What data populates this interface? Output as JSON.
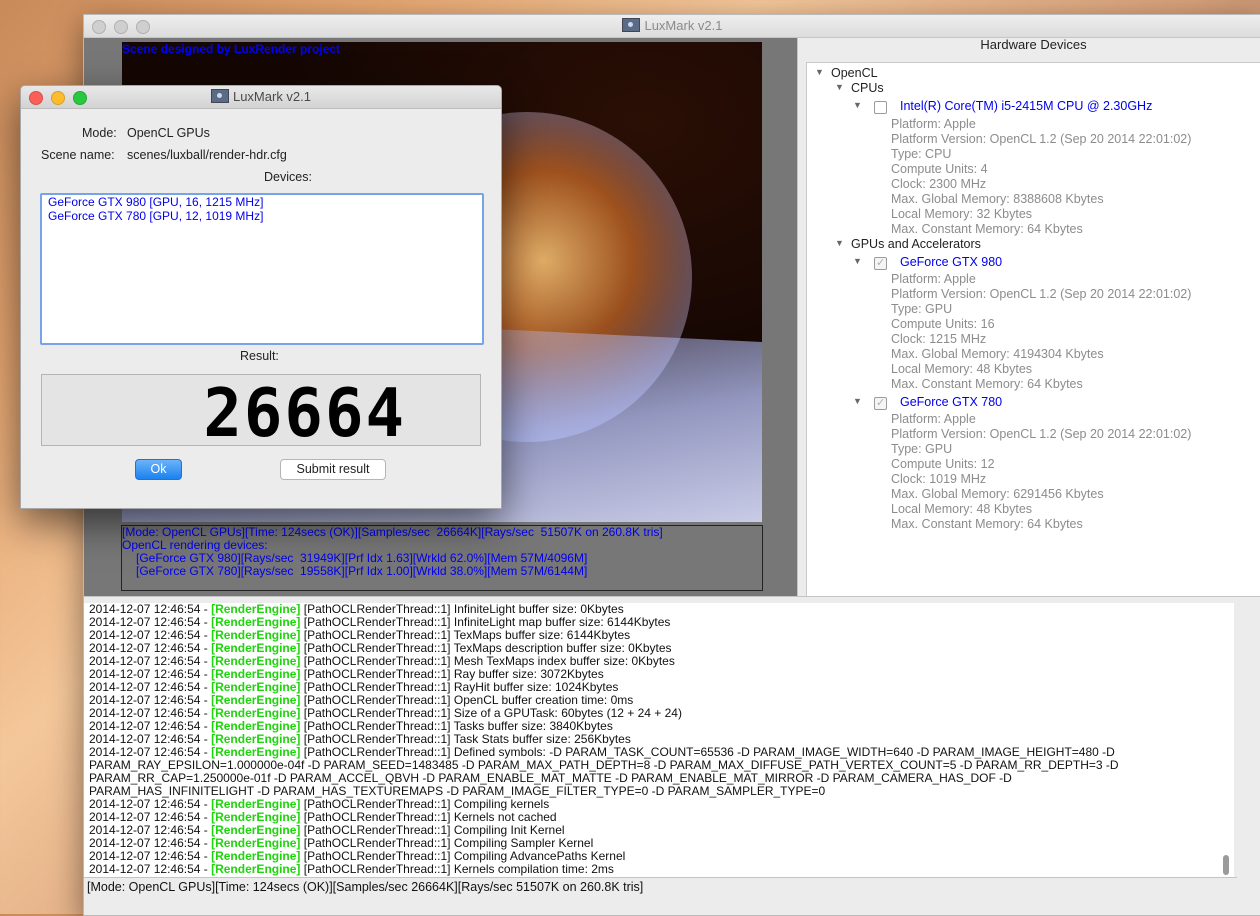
{
  "main_window": {
    "title": "LuxMark v2.1"
  },
  "render": {
    "scene_credit": "Scene designed by LuxRender project",
    "stats_lines": [
      "[Mode: OpenCL GPUs][Time: 124secs (OK)][Samples/sec  26664K][Rays/sec  51507K on 260.8K tris]",
      "",
      "OpenCL rendering devices:",
      "[GeForce GTX 980][Rays/sec  31949K][Prf Idx 1.63][Wrkld 62.0%][Mem 57M/4096M]",
      "[GeForce GTX 780][Rays/sec  19558K][Prf Idx 1.00][Wrkld 38.0%][Mem 57M/6144M]"
    ]
  },
  "hardware": {
    "title": "Hardware Devices",
    "root": "OpenCL",
    "cpus_label": "CPUs",
    "gpus_label": "GPUs and Accelerators",
    "cpu": {
      "name": "Intel(R) Core(TM) i5-2415M CPU @ 2.30GHz",
      "checked": false,
      "props": [
        "Platform: Apple",
        "Platform Version: OpenCL 1.2 (Sep 20 2014 22:01:02)",
        "Type: CPU",
        "Compute Units: 4",
        "Clock: 2300 MHz",
        "Max. Global Memory: 8388608 Kbytes",
        "Local Memory: 32 Kbytes",
        "Max. Constant Memory: 64 Kbytes"
      ]
    },
    "gpus": [
      {
        "name": "GeForce GTX 980",
        "checked": true,
        "props": [
          "Platform: Apple",
          "Platform Version: OpenCL 1.2 (Sep 20 2014 22:01:02)",
          "Type: GPU",
          "Compute Units: 16",
          "Clock: 1215 MHz",
          "Max. Global Memory: 4194304 Kbytes",
          "Local Memory: 48 Kbytes",
          "Max. Constant Memory: 64 Kbytes"
        ]
      },
      {
        "name": "GeForce GTX 780",
        "checked": true,
        "props": [
          "Platform: Apple",
          "Platform Version: OpenCL 1.2 (Sep 20 2014 22:01:02)",
          "Type: GPU",
          "Compute Units: 12",
          "Clock: 1019 MHz",
          "Max. Global Memory: 6291456 Kbytes",
          "Local Memory: 48 Kbytes",
          "Max. Constant Memory: 64 Kbytes"
        ]
      }
    ]
  },
  "log": {
    "engine_tag": "[RenderEngine]",
    "lines": [
      {
        "ts": "2014-12-07 12:46:54 - ",
        "eng": true,
        "rest": " [PathOCLRenderThread::1] InfiniteLight buffer size: 0Kbytes"
      },
      {
        "ts": "2014-12-07 12:46:54 - ",
        "eng": true,
        "rest": " [PathOCLRenderThread::1] InfiniteLight map buffer size: 6144Kbytes"
      },
      {
        "ts": "2014-12-07 12:46:54 - ",
        "eng": true,
        "rest": " [PathOCLRenderThread::1] TexMaps buffer size: 6144Kbytes"
      },
      {
        "ts": "2014-12-07 12:46:54 - ",
        "eng": true,
        "rest": " [PathOCLRenderThread::1] TexMaps description buffer size: 0Kbytes"
      },
      {
        "ts": "2014-12-07 12:46:54 - ",
        "eng": true,
        "rest": " [PathOCLRenderThread::1] Mesh TexMaps index buffer size: 0Kbytes"
      },
      {
        "ts": "2014-12-07 12:46:54 - ",
        "eng": true,
        "rest": " [PathOCLRenderThread::1] Ray buffer size: 3072Kbytes"
      },
      {
        "ts": "2014-12-07 12:46:54 - ",
        "eng": true,
        "rest": " [PathOCLRenderThread::1] RayHit buffer size: 1024Kbytes"
      },
      {
        "ts": "2014-12-07 12:46:54 - ",
        "eng": true,
        "rest": " [PathOCLRenderThread::1] OpenCL buffer creation time: 0ms"
      },
      {
        "ts": "2014-12-07 12:46:54 - ",
        "eng": true,
        "rest": " [PathOCLRenderThread::1] Size of a GPUTask: 60bytes (12 + 24 + 24)"
      },
      {
        "ts": "2014-12-07 12:46:54 - ",
        "eng": true,
        "rest": " [PathOCLRenderThread::1] Tasks buffer size: 3840Kbytes"
      },
      {
        "ts": "2014-12-07 12:46:54 - ",
        "eng": true,
        "rest": " [PathOCLRenderThread::1] Task Stats buffer size: 256Kbytes"
      },
      {
        "ts": "2014-12-07 12:46:54 - ",
        "eng": true,
        "rest": " [PathOCLRenderThread::1] Defined symbols: -D PARAM_TASK_COUNT=65536 -D PARAM_IMAGE_WIDTH=640 -D PARAM_IMAGE_HEIGHT=480 -D"
      },
      {
        "ts": "",
        "eng": false,
        "rest": "PARAM_RAY_EPSILON=1.000000e-04f -D PARAM_SEED=1483485 -D PARAM_MAX_PATH_DEPTH=8 -D PARAM_MAX_DIFFUSE_PATH_VERTEX_COUNT=5 -D PARAM_RR_DEPTH=3 -D"
      },
      {
        "ts": "",
        "eng": false,
        "rest": "PARAM_RR_CAP=1.250000e-01f -D PARAM_ACCEL_QBVH -D PARAM_ENABLE_MAT_MATTE -D PARAM_ENABLE_MAT_MIRROR -D PARAM_CAMERA_HAS_DOF -D"
      },
      {
        "ts": "",
        "eng": false,
        "rest": "PARAM_HAS_INFINITELIGHT -D PARAM_HAS_TEXTUREMAPS -D PARAM_IMAGE_FILTER_TYPE=0 -D PARAM_SAMPLER_TYPE=0"
      },
      {
        "ts": "2014-12-07 12:46:54 - ",
        "eng": true,
        "rest": " [PathOCLRenderThread::1] Compiling kernels"
      },
      {
        "ts": "2014-12-07 12:46:54 - ",
        "eng": true,
        "rest": " [PathOCLRenderThread::1] Kernels not cached"
      },
      {
        "ts": "2014-12-07 12:46:54 - ",
        "eng": true,
        "rest": " [PathOCLRenderThread::1] Compiling Init Kernel"
      },
      {
        "ts": "2014-12-07 12:46:54 - ",
        "eng": true,
        "rest": " [PathOCLRenderThread::1] Compiling Sampler Kernel"
      },
      {
        "ts": "2014-12-07 12:46:54 - ",
        "eng": true,
        "rest": " [PathOCLRenderThread::1] Compiling AdvancePaths Kernel"
      },
      {
        "ts": "2014-12-07 12:46:54 - ",
        "eng": true,
        "rest": " [PathOCLRenderThread::1] Kernels compilation time: 2ms"
      }
    ]
  },
  "status_bar": "[Mode: OpenCL GPUs][Time: 124secs (OK)][Samples/sec  26664K][Rays/sec  51507K on 260.8K tris]",
  "dialog": {
    "title": "LuxMark v2.1",
    "mode_label": "Mode:",
    "mode_value": "OpenCL GPUs",
    "scene_label": "Scene name:",
    "scene_value": "scenes/luxball/render-hdr.cfg",
    "devices_label": "Devices:",
    "devices": [
      "GeForce GTX 980 [GPU, 16, 1215 MHz]",
      "GeForce GTX 780 [GPU, 12, 1019 MHz]"
    ],
    "result_label": "Result:",
    "result_value": "26664",
    "ok_label": "Ok",
    "submit_label": "Submit result"
  }
}
